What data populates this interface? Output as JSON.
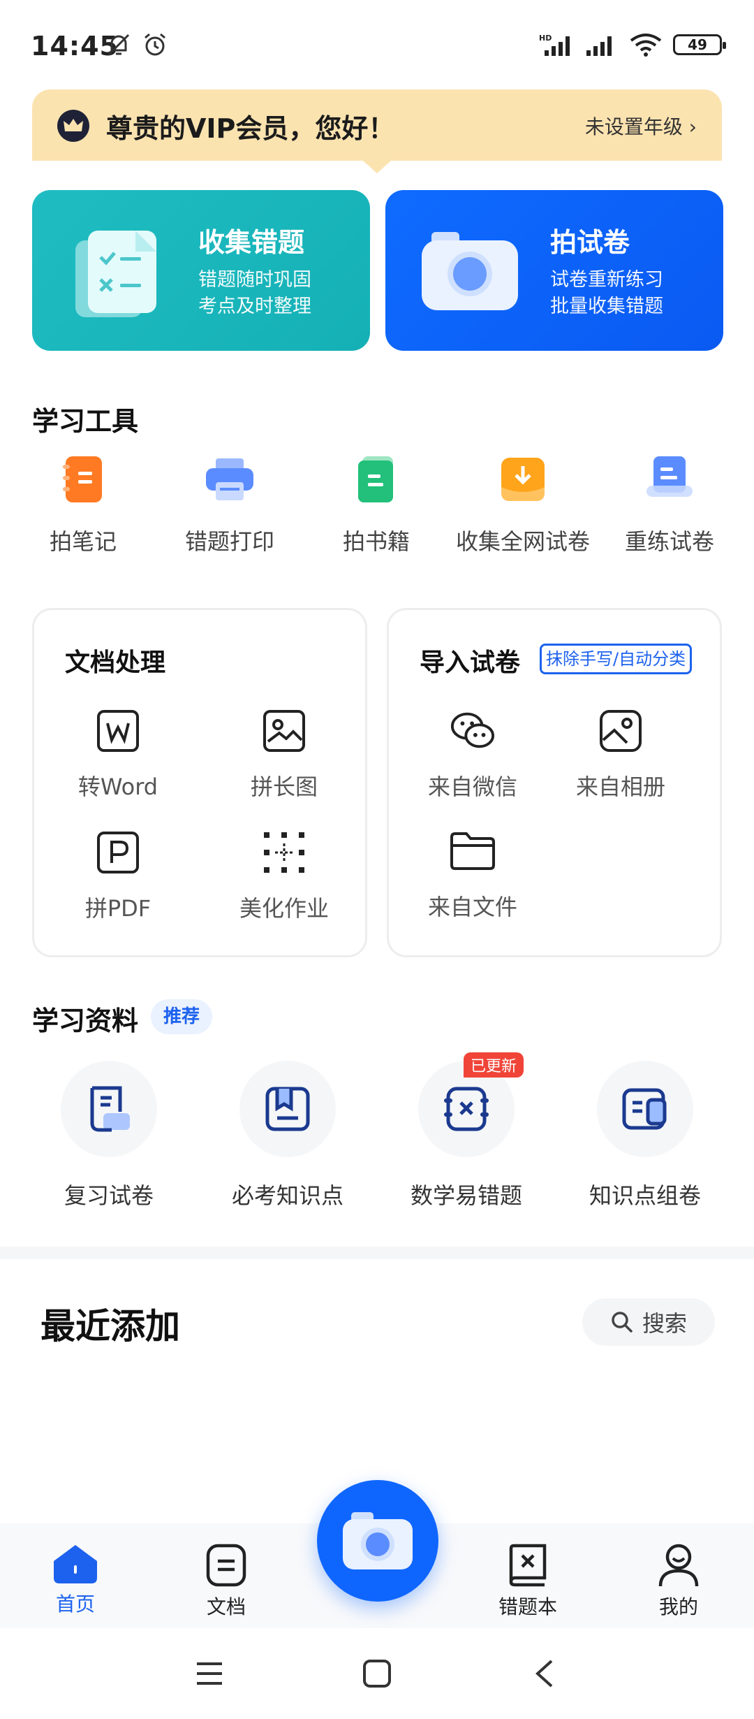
{
  "status_bar": {
    "time": "14:45",
    "battery": "49"
  },
  "vip_banner": {
    "title": "尊贵的VIP会员，您好！",
    "grade_link": "未设置年级 ›"
  },
  "feature_cards": [
    {
      "title": "收集错题",
      "subtitle": "错题随时巩固\n考点及时整理"
    },
    {
      "title": "拍试卷",
      "subtitle": "试卷重新练习\n批量收集错题"
    }
  ],
  "study_tools": {
    "title": "学习工具",
    "items": [
      {
        "label": "拍笔记",
        "color": "#ff7a22"
      },
      {
        "label": "错题打印",
        "color": "#5b8cff"
      },
      {
        "label": "拍书籍",
        "color": "#22c07a"
      },
      {
        "label": "收集全网试卷",
        "color": "#ffa41b"
      },
      {
        "label": "重练试卷",
        "color": "#5b8cff"
      }
    ]
  },
  "doc_processing": {
    "title": "文档处理",
    "items": [
      {
        "label": "转Word",
        "icon": "word-icon"
      },
      {
        "label": "拼长图",
        "icon": "long-image-icon"
      },
      {
        "label": "拼PDF",
        "icon": "pdf-icon"
      },
      {
        "label": "美化作业",
        "icon": "beautify-icon"
      }
    ]
  },
  "import_paper": {
    "title": "导入试卷",
    "tag": "抹除手写/自动分类",
    "items": [
      {
        "label": "来自微信",
        "icon": "wechat-icon"
      },
      {
        "label": "来自相册",
        "icon": "album-icon"
      },
      {
        "label": "来自文件",
        "icon": "folder-icon"
      }
    ]
  },
  "study_materials": {
    "title": "学习资料",
    "tag": "推荐",
    "new_badge": "已更新",
    "items": [
      {
        "label": "复习试卷"
      },
      {
        "label": "必考知识点"
      },
      {
        "label": "数学易错题"
      },
      {
        "label": "知识点组卷"
      }
    ]
  },
  "recent": {
    "title": "最近添加",
    "search_label": "搜索"
  },
  "tab_bar": {
    "items": [
      {
        "label": "首页",
        "active": true
      },
      {
        "label": "文档",
        "active": false
      },
      {
        "label": "错题本",
        "active": false
      },
      {
        "label": "我的",
        "active": false
      }
    ]
  },
  "colors": {
    "accent": "#0f66ff",
    "teal": "#1fbdc2",
    "vip_bg": "#fbe3b0"
  }
}
